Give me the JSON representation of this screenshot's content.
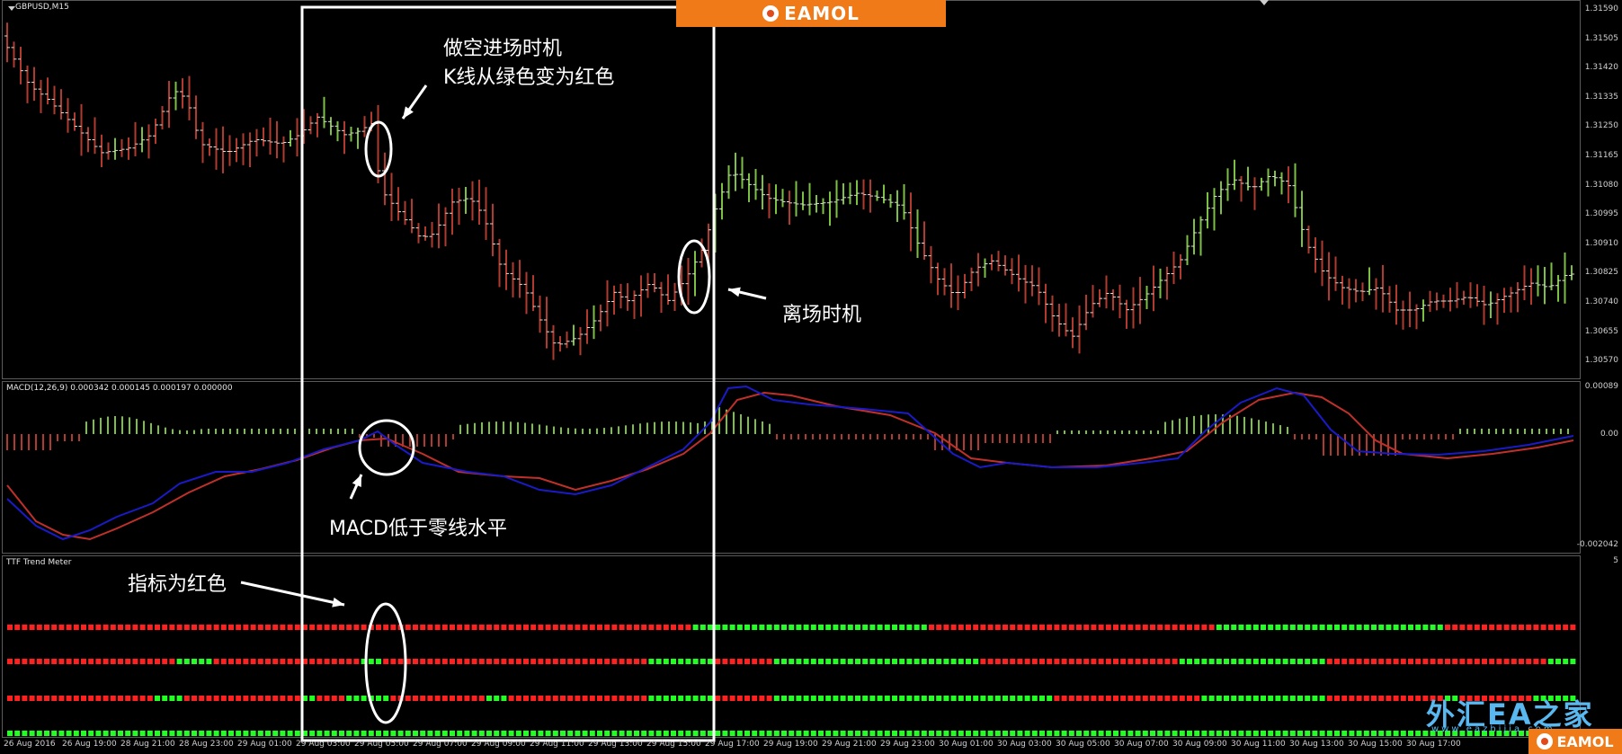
{
  "main": {
    "symbol_label": "GBPUSD,M15",
    "price_ticks": [
      "1.31590",
      "1.31505",
      "1.31420",
      "1.31335",
      "1.31250",
      "1.31165",
      "1.31080",
      "1.30995",
      "1.30910",
      "1.30825",
      "1.30740",
      "1.30655",
      "1.30570"
    ]
  },
  "macd": {
    "label": "MACD(12,26,9) 0.000342 0.000145 0.000197 0.000000",
    "ticks": [
      "0.00089",
      "0.00",
      "-0.002042"
    ]
  },
  "ttf": {
    "label": "TTF Trend Meter",
    "tick": "5"
  },
  "time_axis": [
    "26 Aug 2016",
    "26 Aug 19:00",
    "28 Aug 21:00",
    "28 Aug 23:00",
    "29 Aug 01:00",
    "29 Aug 03:00",
    "29 Aug 05:00",
    "29 Aug 07:00",
    "29 Aug 09:00",
    "29 Aug 11:00",
    "29 Aug 13:00",
    "29 Aug 15:00",
    "29 Aug 17:00",
    "29 Aug 19:00",
    "29 Aug 21:00",
    "29 Aug 23:00",
    "30 Aug 01:00",
    "30 Aug 03:00",
    "30 Aug 05:00",
    "30 Aug 07:00",
    "30 Aug 09:00",
    "30 Aug 11:00",
    "30 Aug 13:00",
    "30 Aug 15:00",
    "30 Aug 17:00"
  ],
  "annotations": {
    "short_entry_line1": "做空进场时机",
    "short_entry_line2": "K线从绿色变为红色",
    "exit": "离场时机",
    "macd_below_zero": "MACD低于零线水平",
    "indicator_red": "指标为红色"
  },
  "branding": {
    "top_logo": "EAMOL",
    "bottom_logo": "EAMOL",
    "watermark": "外汇EA之家",
    "watermark_sub": "www.eazhijia.com"
  },
  "colors": {
    "bull": "#7bc043",
    "bear": "#b03a2e",
    "macd_signal": "#1a1ac8",
    "macd_main": "#c0302a",
    "ttf_red": "#ff2020",
    "ttf_green": "#22ff22",
    "accent": "#f07a18"
  }
}
